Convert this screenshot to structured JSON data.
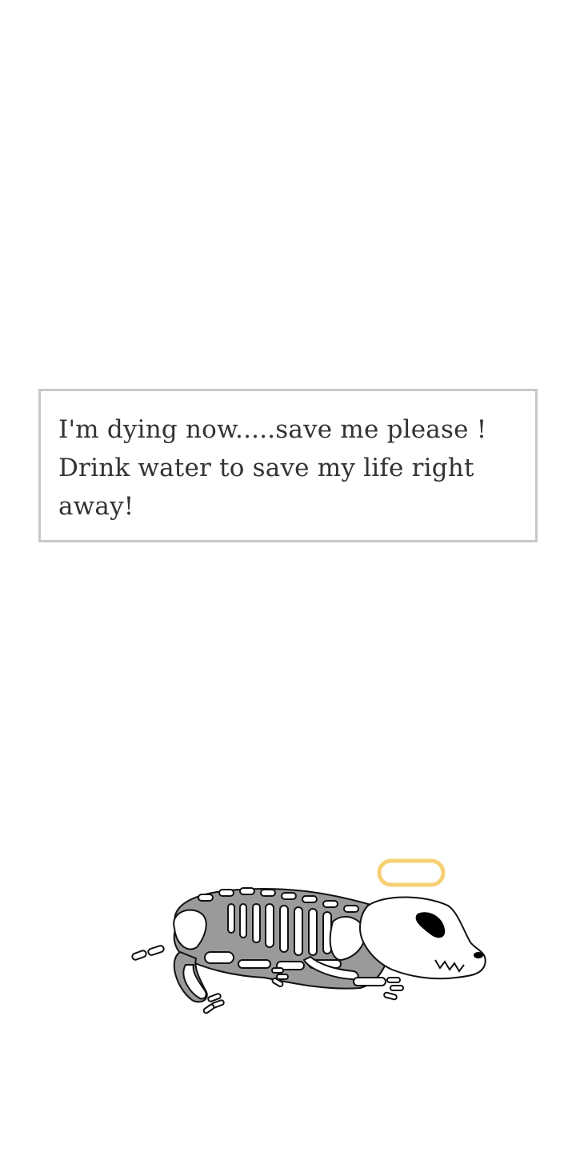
{
  "message": {
    "text": "I'm dying now.....save me please ! Drink water to save my life right away!"
  },
  "illustration": {
    "name": "skeleton-dog",
    "halo_color": "#f7cf73",
    "body_color": "#9a9a9a",
    "eye_color": "#000000"
  }
}
